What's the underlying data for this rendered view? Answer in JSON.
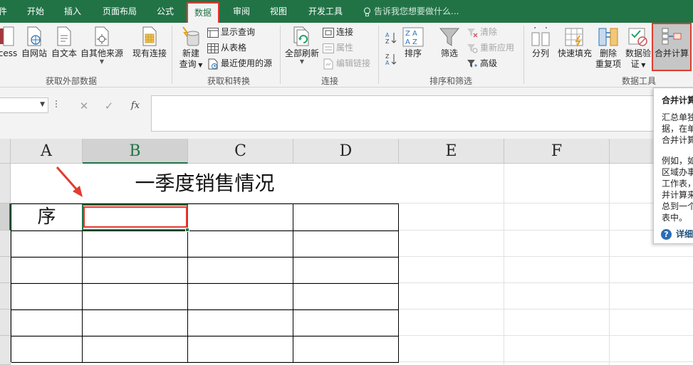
{
  "tabs": [
    {
      "label": "件"
    },
    {
      "label": "开始"
    },
    {
      "label": "插入"
    },
    {
      "label": "页面布局"
    },
    {
      "label": "公式"
    },
    {
      "label": "数据"
    },
    {
      "label": "审阅"
    },
    {
      "label": "视图"
    },
    {
      "label": "开发工具"
    }
  ],
  "tell_me": "告诉我您想要做什么...",
  "ribbon": {
    "get_external": {
      "access": "cess",
      "web": "自网站",
      "text": "自文本",
      "other": "自其他来源",
      "existing": "现有连接",
      "group": "获取外部数据"
    },
    "transform": {
      "new_query_1": "新建",
      "new_query_2": "查询",
      "show_queries": "显示查询",
      "from_table": "从表格",
      "recent_sources": "最近使用的源",
      "group": "获取和转换"
    },
    "connections": {
      "refresh_all": "全部刷新",
      "connections": "连接",
      "properties": "属性",
      "edit_links": "编辑链接",
      "group": "连接"
    },
    "sort_filter": {
      "sort": "排序",
      "filter": "筛选",
      "clear": "清除",
      "reapply": "重新应用",
      "advanced": "高级",
      "group": "排序和筛选"
    },
    "data_tools": {
      "text_to_columns": "分列",
      "flash_fill": "快速填充",
      "remove_dup_1": "删除",
      "remove_dup_2": "重复项",
      "validation_1": "数据验",
      "validation_2": "证",
      "consolidate": "合并计算",
      "group": "数据工具"
    }
  },
  "formula_bar": {
    "cancel": "✕",
    "enter": "✓",
    "fx": "fx",
    "value": ""
  },
  "sheet": {
    "columns": [
      "A",
      "B",
      "C",
      "D",
      "E",
      "F"
    ],
    "title": "一季度销售情况",
    "a3": "序"
  },
  "tooltip": {
    "title": "合并计算",
    "lines_1": [
      "汇总单独",
      "据，在单",
      "合并计算"
    ],
    "lines_2": [
      "例如，如",
      "区域办事",
      "工作表，",
      "并计算来",
      "总到一个",
      "表中。"
    ],
    "help": "详细"
  },
  "colors": {
    "tab_bar": "#217346",
    "highlight": "#e03c31",
    "selection": "#217346"
  }
}
